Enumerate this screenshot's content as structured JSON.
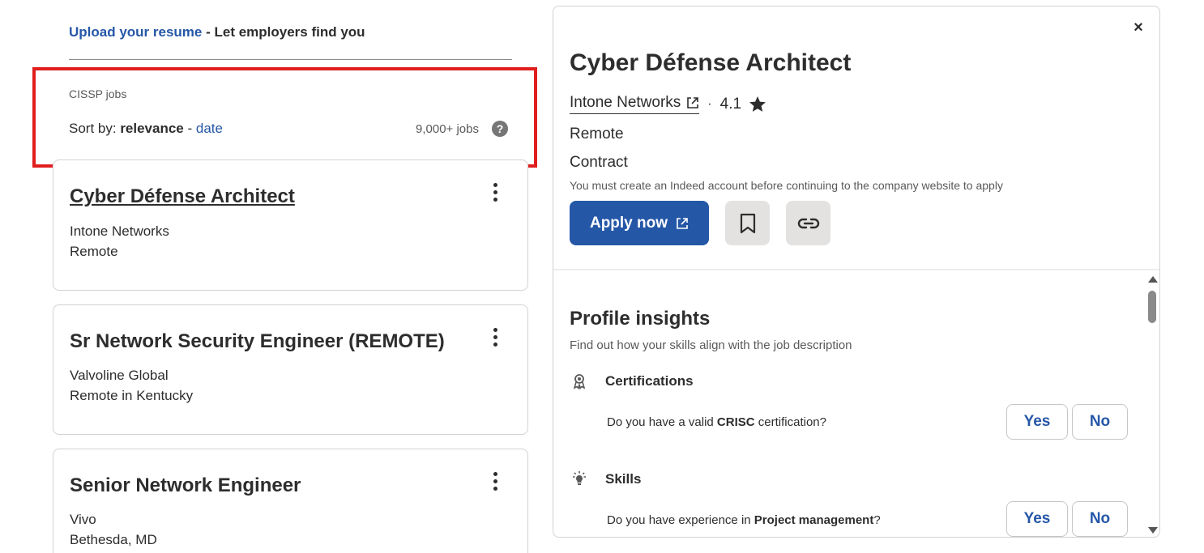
{
  "resume_banner": {
    "link_text": "Upload your resume",
    "rest_text": " - Let employers find you"
  },
  "search": {
    "label": "CISSP jobs",
    "sort_prefix": "Sort by: ",
    "sort_active": "relevance",
    "sort_separator": " - ",
    "sort_option": "date",
    "job_count": "9,000+ jobs",
    "help_glyph": "?"
  },
  "highlight_color": "#e01e1e",
  "jobs": [
    {
      "title": "Cyber Défense Architect",
      "company": "Intone Networks",
      "location": "Remote"
    },
    {
      "title": "Sr Network Security Engineer (REMOTE)",
      "company": "Valvoline Global",
      "location": "Remote in Kentucky"
    },
    {
      "title": "Senior Network Engineer",
      "company": "Vivo",
      "location": "Bethesda, MD"
    }
  ],
  "detail": {
    "close_glyph": "×",
    "title": "Cyber Défense Architect",
    "company": "Intone Networks",
    "separator": "·",
    "rating": "4.1",
    "location": "Remote",
    "job_type": "Contract",
    "note": "You must create an Indeed account before continuing to the company website to apply",
    "apply_label": "Apply now",
    "accent_color": "#2557a7",
    "insights": {
      "title": "Profile insights",
      "subtitle": "Find out how your skills align with the job description",
      "sections": [
        {
          "icon": "award-ribbon-icon",
          "label": "Certifications",
          "question_prefix": "Do you have a valid ",
          "question_bold": "CRISC",
          "question_suffix": " certification?",
          "yes": "Yes",
          "no": "No"
        },
        {
          "icon": "lightbulb-icon",
          "label": "Skills",
          "question_prefix": "Do you have experience in ",
          "question_bold": "Project management",
          "question_suffix": "?",
          "yes": "Yes",
          "no": "No"
        }
      ]
    }
  }
}
